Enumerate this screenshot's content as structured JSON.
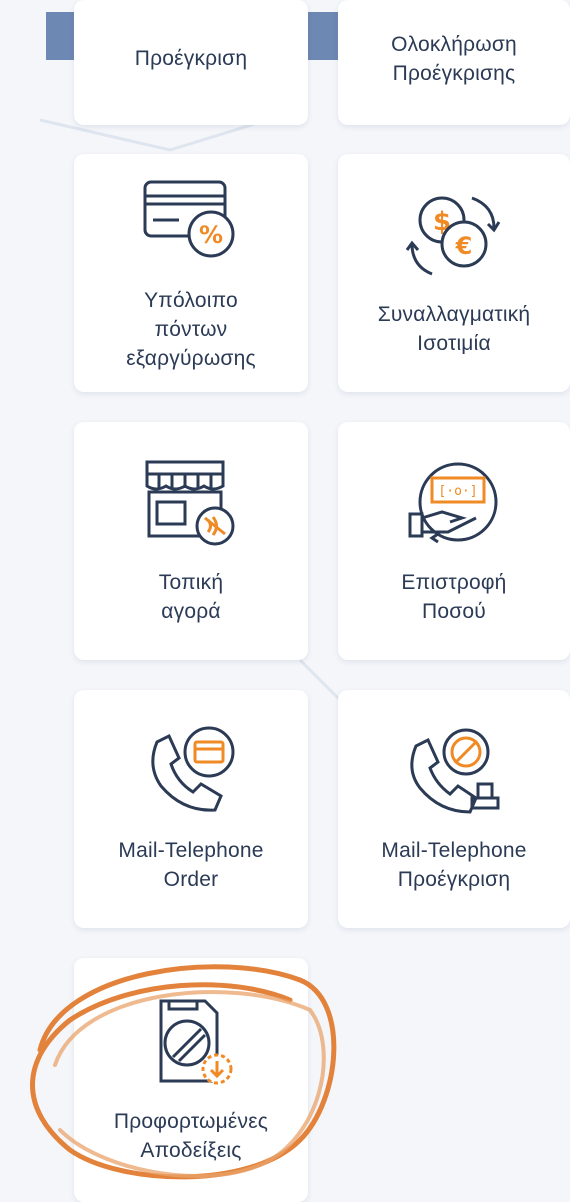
{
  "accent_colors": {
    "navy": "#2b3a55",
    "orange": "#f08a24",
    "band": "#6d88b3",
    "highlight": "#e07526"
  },
  "tiles": [
    {
      "label": "Προέγκριση",
      "icon": "none"
    },
    {
      "label": "Ολοκλήρωση\nΠροέγκρισης",
      "icon": "none"
    },
    {
      "label": "Υπόλοιπο\nπόντων\nεξαργύρωσης",
      "icon": "card-percent-icon"
    },
    {
      "label": "Συναλλαγματική\nΙσοτιμία",
      "icon": "currency-exchange-icon"
    },
    {
      "label": "Τοπική\nαγορά",
      "icon": "local-store-contactless-icon"
    },
    {
      "label": "Επιστροφή\nΠοσού",
      "icon": "refund-hand-icon"
    },
    {
      "label": "Mail-Telephone\nOrder",
      "icon": "phone-card-icon"
    },
    {
      "label": "Mail-Telephone\nΠροέγκριση",
      "icon": "phone-stamp-icon"
    },
    {
      "label": "Προφορτωμένες\nΑποδείξεις",
      "icon": "receipt-download-icon"
    }
  ]
}
